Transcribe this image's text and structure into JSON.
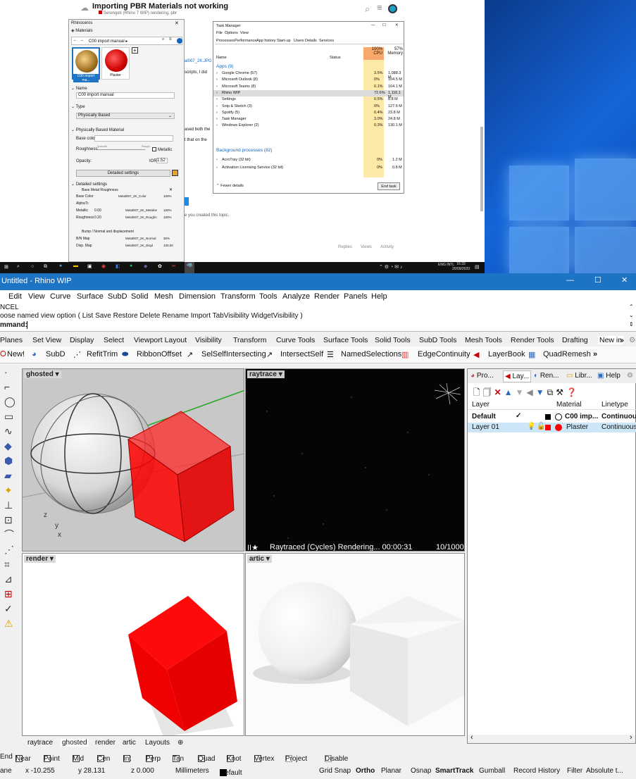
{
  "forum": {
    "title": "Importing PBR Materials not working",
    "subtitle": "Serengeti (Rhino 7 WIP)   rendering, pbr",
    "snippets": [
      "al007_2K.JPG",
      "scripts, I did",
      "ased both the",
      "t that on the",
      "e you created this topic."
    ],
    "footer_stats": [
      "Replies",
      "Views",
      "Activity"
    ]
  },
  "rhinoceros_panel": {
    "title": "Rhinoceros",
    "section": "Materials",
    "breadcrumb": "C00 import manual ▸",
    "thumbs": [
      "C00 import ma...",
      "Plaster"
    ],
    "name_header": "Name",
    "name_value": "C00 import manual",
    "type_header": "Type",
    "type_value": "Physically Based",
    "pbm_header": "Physically Based Material",
    "base_color_label": "Base color:",
    "roughness_label": "Roughness:",
    "roughness_left": "Smooth",
    "roughness_right": "Rough",
    "metallic_label": "Metallic",
    "opacity_label": "Opacity:",
    "ior_label": "IOR:",
    "ior_value": "1.52",
    "detailed_button": "Detailed settings",
    "detailed_header": "Detailed settings",
    "bmr_header": "Base Metal Roughness",
    "rows": [
      {
        "label": "Base Color",
        "value": "",
        "tex": "Metal007_2K_Color",
        "pct": "100%"
      },
      {
        "label": "AlphaTr.",
        "value": "",
        "tex": "",
        "pct": ""
      },
      {
        "label": "Metallic",
        "value": "0.00",
        "tex": "Metal007_2K_Metalne",
        "pct": "100%"
      },
      {
        "label": "Roughness",
        "value": "0.20",
        "tex": "Metal007_2K_Roughn",
        "pct": "100%"
      }
    ],
    "bump_header": "Bump / Normal and displacement",
    "bump_rows": [
      {
        "label": "B/N Map",
        "tex": "Metal007_2K_Normal",
        "pct": "30%"
      },
      {
        "label": "Disp. Map",
        "tex": "Metal007_2K_Displ",
        "pct": "100.00"
      }
    ]
  },
  "task_manager": {
    "title": "Task Manager",
    "menu": [
      "File",
      "Options",
      "View"
    ],
    "tabs": [
      "Processes",
      "Performance",
      "App history",
      "Start-up",
      "Users",
      "Details",
      "Services"
    ],
    "col_name": "Name",
    "col_status": "Status",
    "cpu_pct": "100%",
    "cpu_label": "CPU",
    "mem_pct": "57%",
    "mem_label": "Memory",
    "apps_header": "Apps (9)",
    "apps": [
      {
        "name": "Google Chrome (57)",
        "cpu": "3.5%",
        "mem": "1,088.3 M"
      },
      {
        "name": "Microsoft Outlook (8)",
        "cpu": "0%",
        "mem": "104.5 M"
      },
      {
        "name": "Microsoft Teams (8)",
        "cpu": "0.1%",
        "mem": "164.1 M"
      },
      {
        "name": "Rhino WIP",
        "cpu": "72.6%",
        "mem": "1,116.1 M"
      },
      {
        "name": "Settings",
        "cpu": "0.5%",
        "mem": "8.8 M"
      },
      {
        "name": "Snip & Sketch (3)",
        "cpu": "0%",
        "mem": "127.5 M"
      },
      {
        "name": "Spotify (5)",
        "cpu": "0.4%",
        "mem": "23.8 M"
      },
      {
        "name": "Task Manager",
        "cpu": "3.0%",
        "mem": "24.8 M"
      },
      {
        "name": "Windows Explorer (2)",
        "cpu": "0.3%",
        "mem": "130.1 M"
      }
    ],
    "bg_header": "Background processes (82)",
    "bg": [
      {
        "name": "AcroTray (32 bit)",
        "cpu": "0%",
        "mem": "1.2 M"
      },
      {
        "name": "Activation Licensing Service (32 bit)",
        "cpu": "0%",
        "mem": "0.8 M"
      }
    ],
    "fewer": "Fewer details",
    "end_task": "End task"
  },
  "taskbar": {
    "lang": "ENG INTL",
    "time": "16:33",
    "date": "20/09/2020"
  },
  "rhino": {
    "title": "Untitled - Rhino WIP",
    "menu": [
      "Edit",
      "View",
      "Curve",
      "Surface",
      "SubD",
      "Solid",
      "Mesh",
      "Dimension",
      "Transform",
      "Tools",
      "Analyze",
      "Render",
      "Panels",
      "Help"
    ],
    "cmd_lines": [
      "NCEL",
      "oose named view option ( List  Save  Restore  Delete  Rename  Import  TabVisibility  WidgetVisibility )"
    ],
    "cmd_prompt": "mmand:",
    "tool_tabs": [
      "Planes",
      "Set View",
      "Display",
      "Select",
      "Viewport Layout",
      "Visibility",
      "Transform",
      "Curve Tools",
      "Surface Tools",
      "Solid Tools",
      "SubD Tools",
      "Mesh Tools",
      "Render Tools",
      "Drafting",
      "New in"
    ],
    "tools": [
      "New!",
      "SubD",
      "RefitTrim",
      "RibbonOffset",
      "SelSelfIntersecting",
      "IntersectSelf",
      "NamedSelections",
      "EdgeContinuity",
      "LayerBook",
      "QuadRemesh"
    ],
    "viewports": [
      "ghosted",
      "raytrace",
      "render",
      "artic"
    ],
    "raytrace_status": "Raytraced (Cycles)   Rendering...   00:00:31",
    "raytrace_samples": "10/1000",
    "vp_tabs": [
      "raytrace",
      "ghosted",
      "render",
      "artic",
      "Layouts"
    ],
    "panel_tabs": [
      "Pro...",
      "Lay...",
      "Ren...",
      "Libr...",
      "Help"
    ],
    "layer_headers": [
      "Layer",
      "Material",
      "Linetype"
    ],
    "layers": [
      {
        "name": "Default",
        "material": "C00 imp...",
        "linetype": "Continuous",
        "current": "✓"
      },
      {
        "name": "Layer 01",
        "material": "Plaster",
        "linetype": "Continuous",
        "current": ""
      }
    ],
    "osnap": [
      "End",
      "Near",
      "Point",
      "Mid",
      "Cen",
      "Int",
      "Perp",
      "Tan",
      "Quad",
      "Knot",
      "Vertex",
      "Project",
      "Disable"
    ],
    "status": {
      "plane": "ane",
      "x": "x -10.255",
      "y": "y 28.131",
      "z": "z 0.000",
      "units": "Millimeters",
      "layer": "Default",
      "toggles": [
        "Grid Snap",
        "Ortho",
        "Planar",
        "Osnap",
        "SmartTrack",
        "Gumball",
        "Record History",
        "Filter",
        "Absolute t..."
      ]
    }
  }
}
